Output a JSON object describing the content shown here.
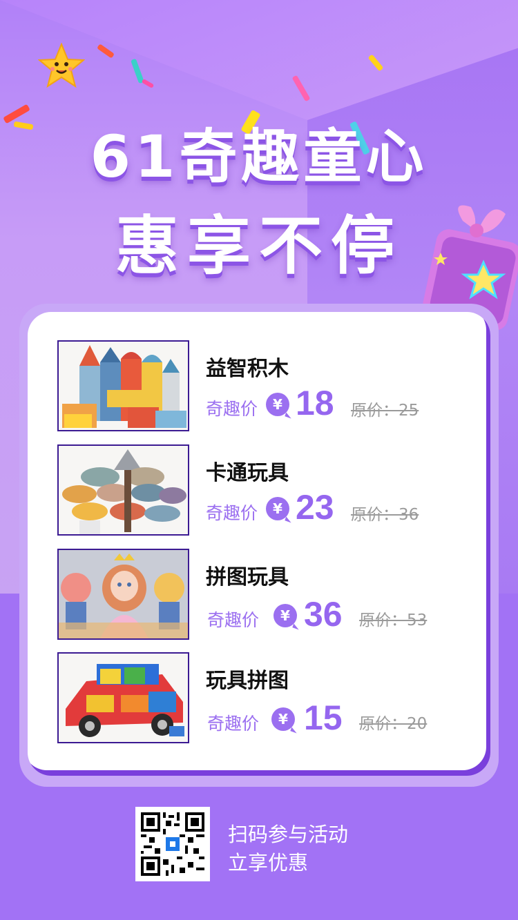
{
  "poster": {
    "title_line1": "61奇趣童心",
    "title_line2": "惠享不停"
  },
  "products": [
    {
      "name": "益智积木",
      "price_label": "奇趣价",
      "currency": "¥",
      "price": "18",
      "original": "原价：25"
    },
    {
      "name": "卡通玩具",
      "price_label": "奇趣价",
      "currency": "¥",
      "price": "23",
      "original": "原价：36"
    },
    {
      "name": "拼图玩具",
      "price_label": "奇趣价",
      "currency": "¥",
      "price": "36",
      "original": "原价：53"
    },
    {
      "name": "玩具拼图",
      "price_label": "奇趣价",
      "currency": "¥",
      "price": "15",
      "original": "原价：20"
    }
  ],
  "footer": {
    "scan_line1": "扫码参与活动",
    "scan_line2": "立享优惠"
  },
  "colors": {
    "accent": "#9566ef",
    "background": "#a272f5",
    "card": "#ffffff"
  }
}
